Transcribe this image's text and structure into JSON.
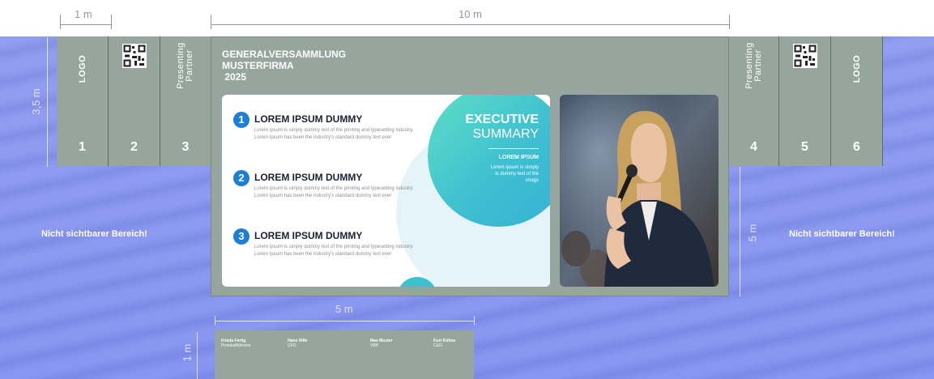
{
  "dimensions": {
    "side_width": "1 m",
    "screen_width": "10 m",
    "side_height": "3,5 m",
    "screen_height": "5 m",
    "lower_width": "5 m",
    "lower_height": "1 m"
  },
  "left_panel": {
    "logo": "LOGO",
    "partner": [
      "Presenting",
      "Partner"
    ],
    "numbers": [
      "1",
      "2",
      "3"
    ]
  },
  "right_panel": {
    "logo": "LOGO",
    "partner": [
      "Presenting",
      "Partner"
    ],
    "numbers": [
      "4",
      "5",
      "6"
    ]
  },
  "main_screen": {
    "title_lines": [
      "GENERALVERSAMMLUNG",
      "MUSTERFIRMA",
      " 2025"
    ],
    "items": [
      {
        "num": "1",
        "heading": "LOREM IPSUM DUMMY",
        "body": "Lorem Ipsum is simply dummy text of the printing and typesetting industry. Lorem Ipsum has been the industry's standard dummy text ever"
      },
      {
        "num": "2",
        "heading": "LOREM IPSUM DUMMY",
        "body": "Lorem Ipsum is simply dummy text of the printing and typesetting industry. Lorem Ipsum has been the industry's standard dummy text ever"
      },
      {
        "num": "3",
        "heading": "LOREM IPSUM DUMMY",
        "body": "Lorem Ipsum is simply dummy text of the printing and typesetting industry. Lorem Ipsum has been the industry's standard dummy text ever"
      }
    ],
    "summary_title": "EXECUTIVE",
    "summary_subtitle": "SUMMARY",
    "summary_heading": "LOREM IPSUM",
    "summary_text": "Lorem ipsum is simply is dummy text of the imags"
  },
  "invisible_area_left": "Nicht sichtbarer Bereich!",
  "invisible_area_right": "Nicht sichtbarer Bereich!",
  "lower_screen": {
    "people": [
      {
        "name": "Frieda Fertig",
        "role": "Protokollführerin"
      },
      {
        "name": "Hans Hilfe",
        "role": "CFO"
      },
      {
        "name": "Max Muster",
        "role": "VRP"
      },
      {
        "name": "Kurt Kühne",
        "role": "CEO"
      }
    ]
  },
  "colors": {
    "background": "#8a97ef",
    "panel": "#96a69e",
    "accent_blue": "#1e7fd2",
    "accent_teal": "#3fbfd0"
  }
}
